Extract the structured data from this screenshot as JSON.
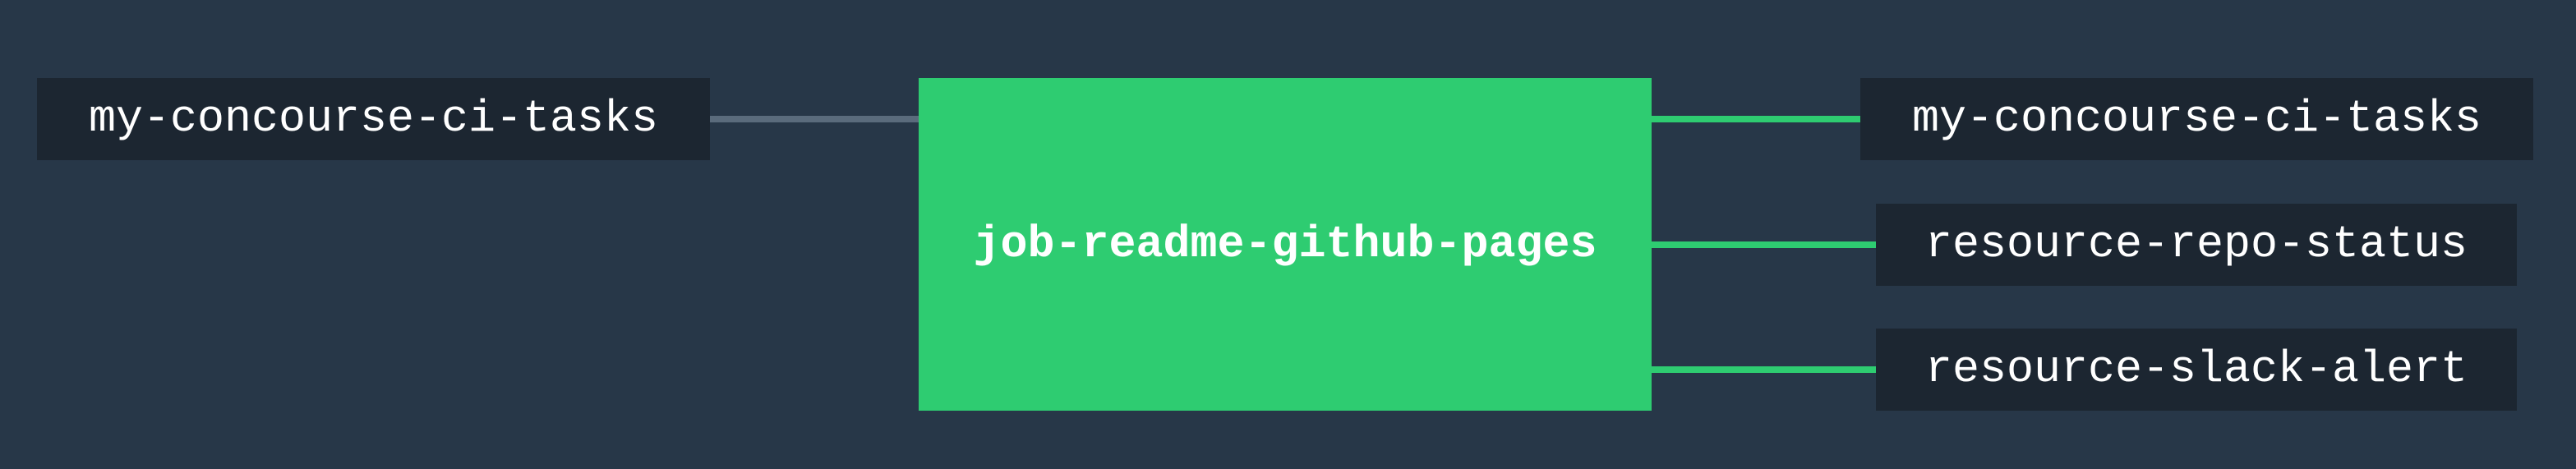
{
  "colors": {
    "background": "#273748",
    "resource_box": "#1c2631",
    "job_succeeded": "#2ecc71",
    "input_line": "#5a6b7c",
    "output_line": "#2ecc71",
    "text": "#ffffff"
  },
  "pipeline": {
    "inputs": [
      {
        "label": "my-concourse-ci-tasks"
      }
    ],
    "job": {
      "label": "job-readme-github-pages",
      "status": "succeeded"
    },
    "outputs": [
      {
        "label": "my-concourse-ci-tasks"
      },
      {
        "label": "resource-repo-status"
      },
      {
        "label": "resource-slack-alert"
      }
    ]
  }
}
